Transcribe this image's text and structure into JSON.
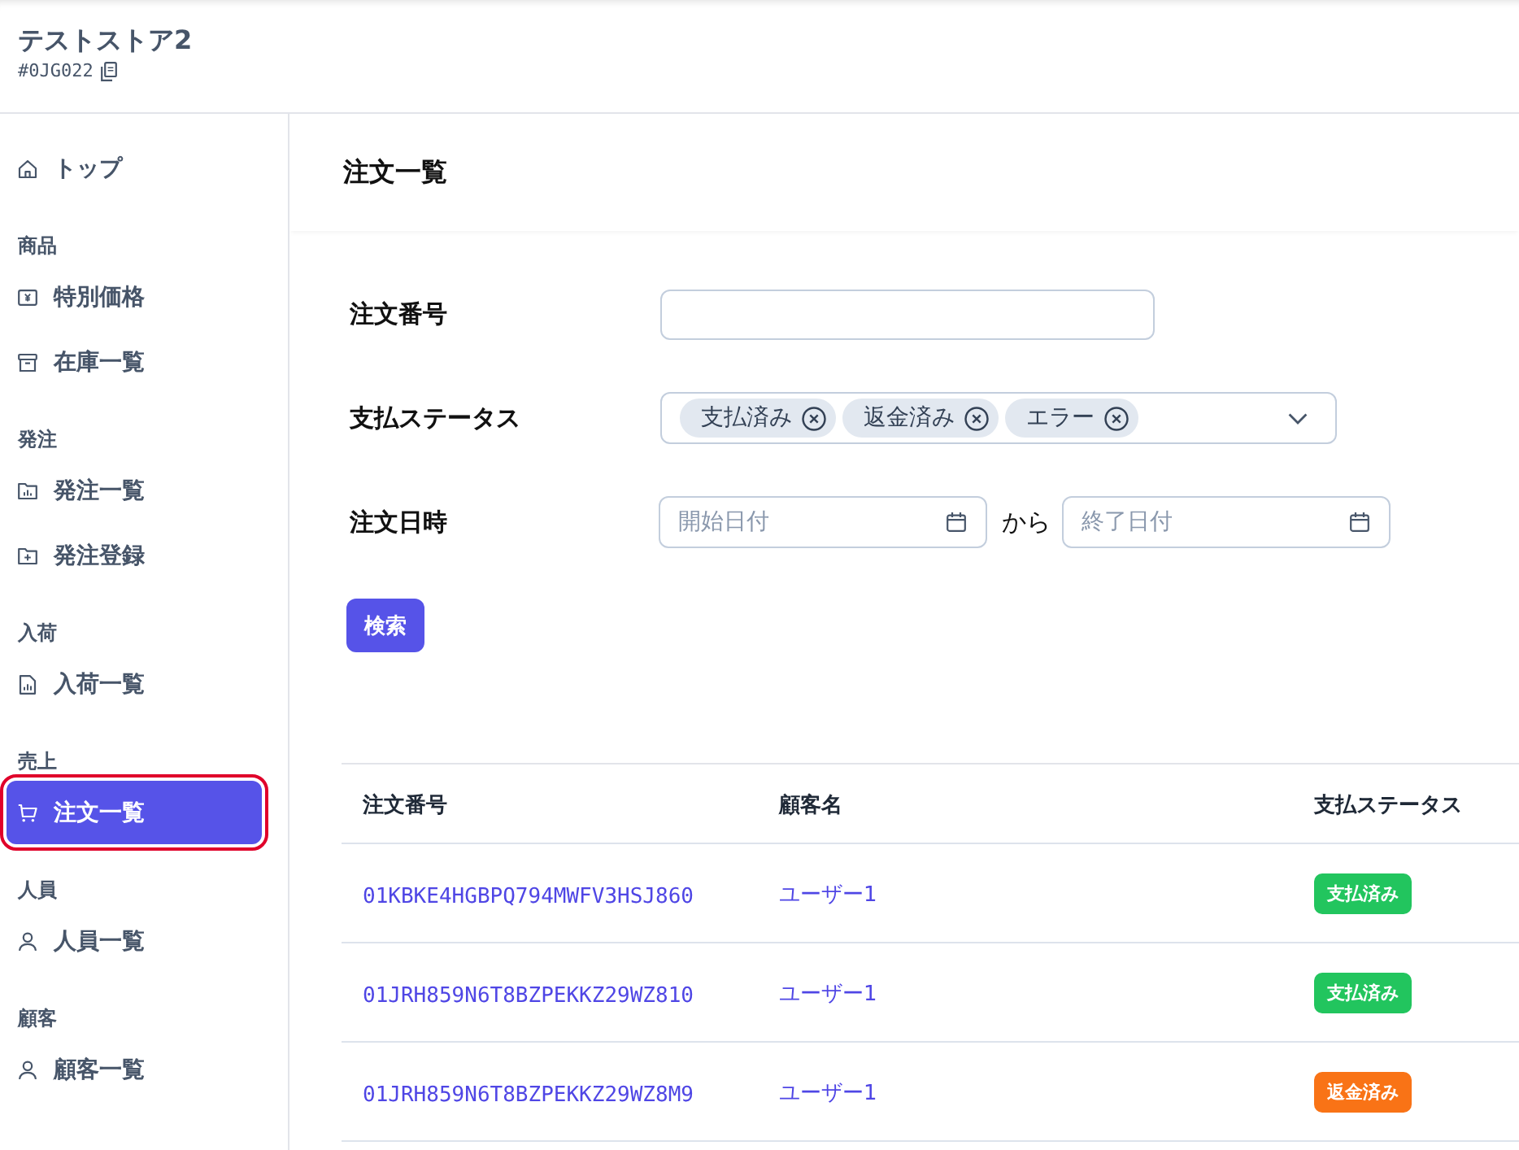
{
  "store": {
    "name": "テストストア2",
    "id": "#0JG022"
  },
  "sidebar": {
    "top_items": [
      {
        "label": "トップ",
        "selected": false
      }
    ],
    "sections": [
      {
        "heading": "商品",
        "items": [
          {
            "label": "特別価格",
            "selected": false
          },
          {
            "label": "在庫一覧",
            "selected": false
          }
        ]
      },
      {
        "heading": "発注",
        "items": [
          {
            "label": "発注一覧",
            "selected": false
          },
          {
            "label": "発注登録",
            "selected": false
          }
        ]
      },
      {
        "heading": "入荷",
        "items": [
          {
            "label": "入荷一覧",
            "selected": false
          }
        ]
      },
      {
        "heading": "売上",
        "items": [
          {
            "label": "注文一覧",
            "selected": true
          }
        ]
      },
      {
        "heading": "人員",
        "items": [
          {
            "label": "人員一覧",
            "selected": false
          }
        ]
      },
      {
        "heading": "顧客",
        "items": [
          {
            "label": "顧客一覧",
            "selected": false
          }
        ]
      }
    ]
  },
  "page_title": "注文一覧",
  "filters": {
    "order_number": {
      "label": "注文番号"
    },
    "payment_status": {
      "label": "支払ステータス",
      "chips": [
        "支払済み",
        "返金済み",
        "エラー"
      ]
    },
    "order_date": {
      "label": "注文日時",
      "start": {
        "placeholder": "開始日付"
      },
      "separator": "から",
      "end": {
        "placeholder": "終了日付"
      }
    },
    "search_button": "検索"
  },
  "table": {
    "columns": [
      "注文番号",
      "顧客名",
      "支払ステータス"
    ],
    "rows": [
      {
        "order_number": "01KBKE4HGBPQ794MWFV3HSJ860",
        "customer": "ユーザー1",
        "status": {
          "label": "支払済み",
          "color": "#22c55e"
        }
      },
      {
        "order_number": "01JRH859N6T8BZPEKKZ29WZ810",
        "customer": "ユーザー1",
        "status": {
          "label": "支払済み",
          "color": "#22c55e"
        }
      },
      {
        "order_number": "01JRH859N6T8BZPEKKZ29WZ8M9",
        "customer": "ユーザー1",
        "status": {
          "label": "返金済み",
          "color": "#f97316"
        }
      }
    ]
  }
}
